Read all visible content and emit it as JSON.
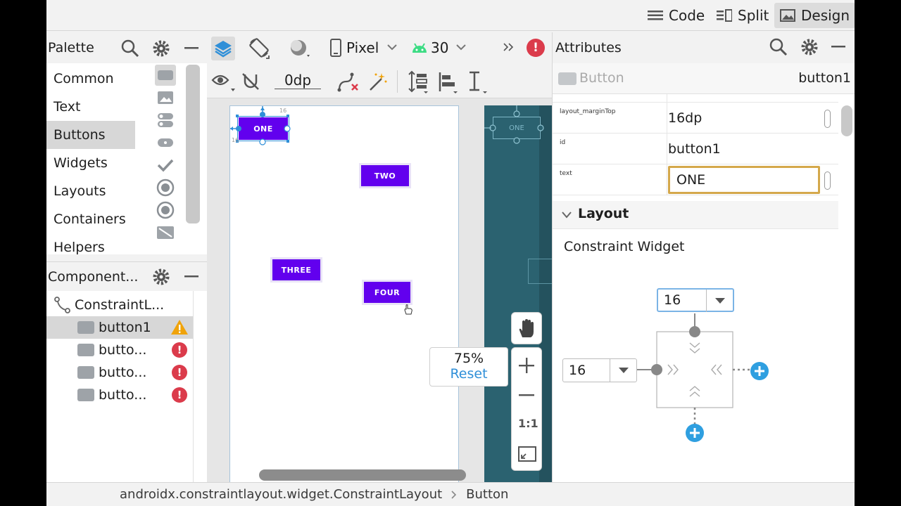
{
  "modes": {
    "code": "Code",
    "split": "Split",
    "design": "Design"
  },
  "palette": {
    "title": "Palette",
    "categories": [
      "Common",
      "Text",
      "Buttons",
      "Widgets",
      "Layouts",
      "Containers",
      "Helpers"
    ],
    "selected_category": "Buttons"
  },
  "toolbar": {
    "device": "Pixel",
    "api": "30",
    "margin": "0dp"
  },
  "component_tree": {
    "title": "Component...",
    "root": "ConstraintL...",
    "items": [
      "button1",
      "butto...",
      "butto...",
      "butto..."
    ]
  },
  "canvas": {
    "buttons": [
      "ONE",
      "TWO",
      "THREE",
      "FOUR"
    ],
    "guide_value": "16",
    "blueprint_label": "ONE",
    "zoom": {
      "level": "75%",
      "reset": "Reset"
    },
    "zoom_fit": "1:1"
  },
  "attributes": {
    "title": "Attributes",
    "widget_type": "Button",
    "widget_id": "button1",
    "rows": [
      {
        "label": "layout_marginTop",
        "value": "16dp"
      },
      {
        "label": "id",
        "value": "button1"
      },
      {
        "label": "text",
        "value": "ONE"
      }
    ],
    "layout_section": "Layout",
    "constraint_title": "Constraint Widget",
    "margin_top": "16",
    "margin_left": "16"
  },
  "breadcrumb": {
    "path": "androidx.constraintlayout.widget.ConstraintLayout",
    "leaf": "Button"
  },
  "colors": {
    "accent": "#6200ee",
    "error": "#db3b4b",
    "warning": "#f0a30a",
    "link": "#2f8fd8",
    "blueprint": "#2b6270"
  }
}
